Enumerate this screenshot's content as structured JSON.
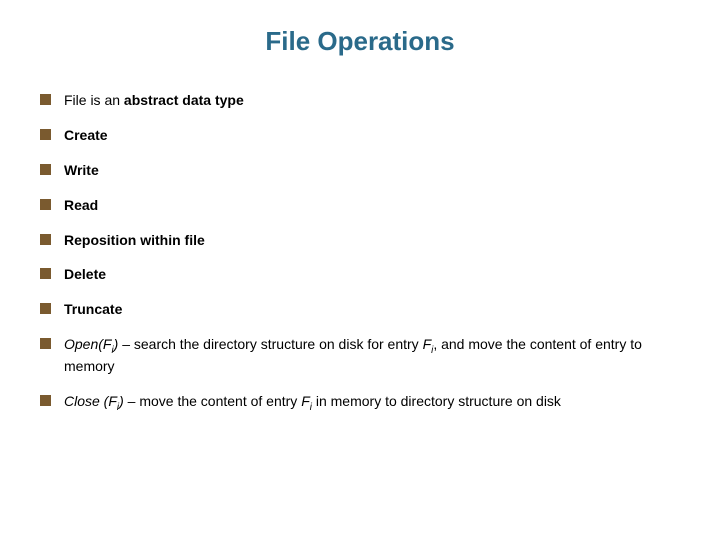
{
  "title": "File Operations",
  "items": {
    "i0": {
      "prefix": "File is an ",
      "bold": "abstract data type"
    },
    "i1": "Create",
    "i2": "Write",
    "i3": "Read",
    "i4": "Reposition within file",
    "i5": "Delete",
    "i6": "Truncate",
    "i7": {
      "lead": "Open(F",
      "sub": "i",
      "afterParen": ")",
      "mid1": " – search the directory structure on disk for entry ",
      "fvar": "F",
      "fsub": "i",
      "mid2": ", and move the content of entry to memory"
    },
    "i8": {
      "lead": "Close (F",
      "sub": "i",
      "afterParen": ")",
      "mid1": " – move the content of entry ",
      "fvar": "F",
      "fsub": "i",
      "mid2": " in memory to directory structure on disk"
    }
  }
}
